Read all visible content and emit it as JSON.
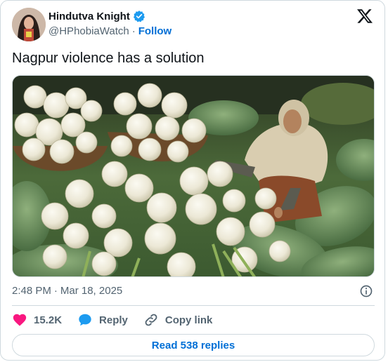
{
  "author": {
    "display_name": "Hindutva Knight",
    "handle": "@HPhobiaWatch",
    "separator": "·",
    "follow_label": "Follow",
    "avatar_icon": "profile-avatar",
    "verified_icon": "verified-badge-icon",
    "verified_color": "#1d9bf0"
  },
  "platform": {
    "logo_icon": "x-logo-icon"
  },
  "tweet": {
    "text": "Nagpur violence has a solution",
    "media_icon": "cauliflower-harvest-photo"
  },
  "meta": {
    "time": "2:48 PM",
    "separator": "·",
    "date": "Mar 18, 2025",
    "info_icon": "info-icon"
  },
  "actions": {
    "like_count": "15.2K",
    "like_color": "#f91880",
    "reply_label": "Reply",
    "reply_color": "#1d9bf0",
    "copy_label": "Copy link"
  },
  "footer": {
    "read_replies_label": "Read 538 replies"
  },
  "colors": {
    "text_primary": "#0f1419",
    "text_secondary": "#536471",
    "link": "#006fd6",
    "border": "#cfd9de"
  }
}
